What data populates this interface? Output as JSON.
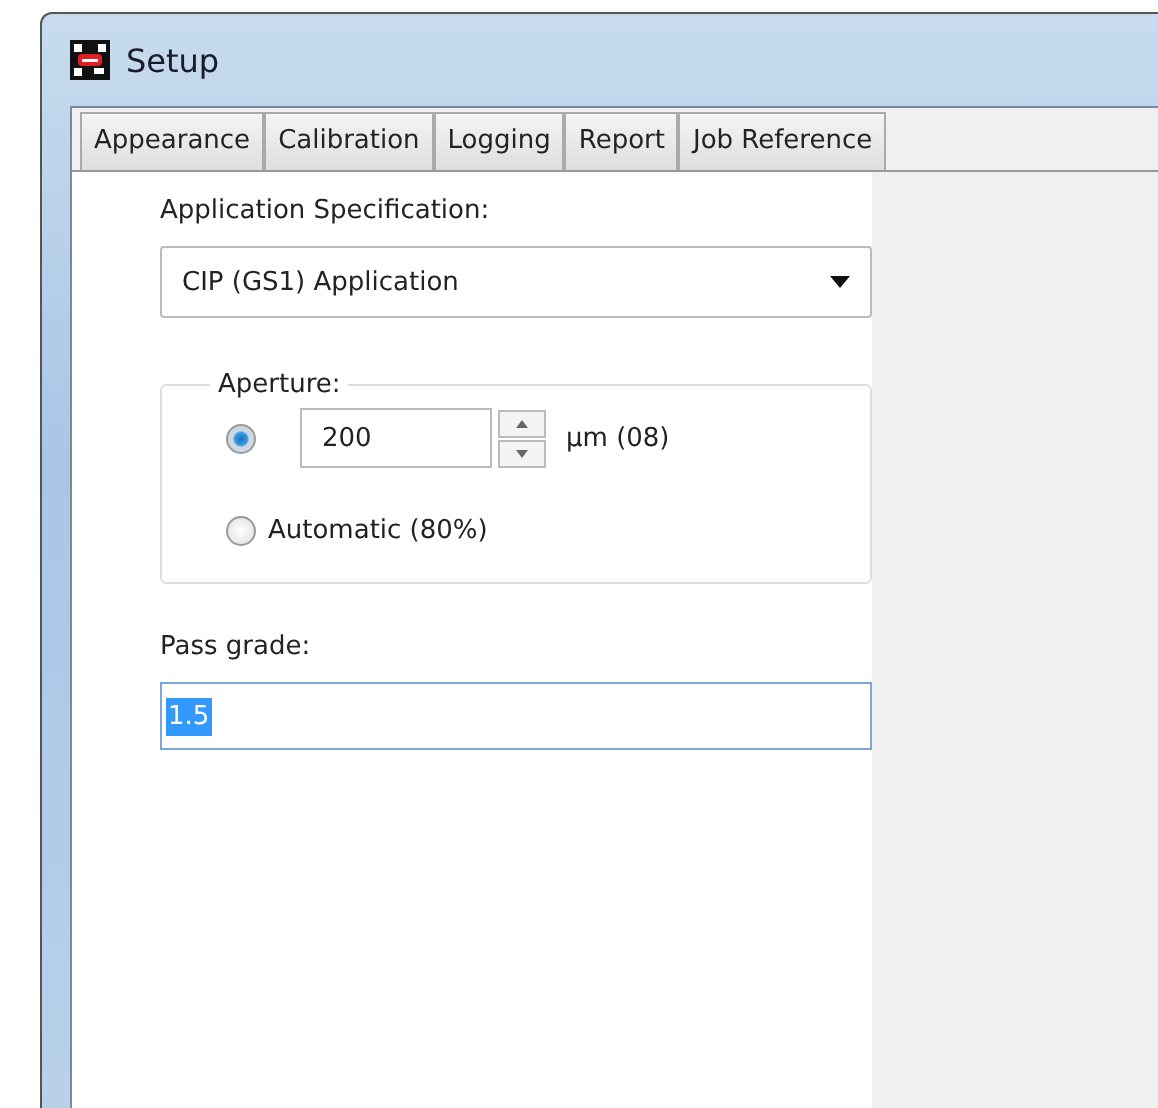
{
  "window": {
    "title": "Setup"
  },
  "tabs": [
    {
      "label": "Appearance"
    },
    {
      "label": "Calibration"
    },
    {
      "label": "Logging"
    },
    {
      "label": "Report"
    },
    {
      "label": "Job Reference"
    }
  ],
  "application_specification": {
    "label": "Application Specification:",
    "value": "CIP (GS1) Application"
  },
  "aperture": {
    "legend": "Aperture:",
    "options": [
      {
        "kind": "value",
        "selected": true,
        "value": "200",
        "unit": "µm (08)"
      },
      {
        "kind": "auto",
        "selected": false,
        "label": "Automatic (80%)"
      }
    ]
  },
  "pass_grade": {
    "label": "Pass grade:",
    "value": "1.5"
  }
}
